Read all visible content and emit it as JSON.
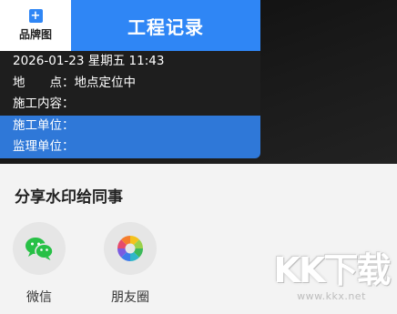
{
  "watermark": {
    "brand_label": "品牌图",
    "brand_plus": "+",
    "title": "工程记录",
    "datetime": "2026-01-23 星期五 11:43",
    "location_label": "地　　点：",
    "location_value": "地点定位中",
    "content_label": "施工内容：",
    "content_value": "",
    "company_label": "施工单位：",
    "company_value": "",
    "supervisor_label": "监理单位：",
    "supervisor_value": ""
  },
  "share": {
    "title": "分享水印给同事",
    "options": [
      {
        "label": "微信",
        "icon": "wechat-icon"
      },
      {
        "label": "朋友圈",
        "icon": "moments-icon"
      }
    ]
  },
  "site_watermark": {
    "logo": "KK下载",
    "url": "www.kkx.net"
  },
  "colors": {
    "accent_blue": "#2f86f5",
    "row_blue": "#2f78d8",
    "wechat_green": "#27c046"
  }
}
